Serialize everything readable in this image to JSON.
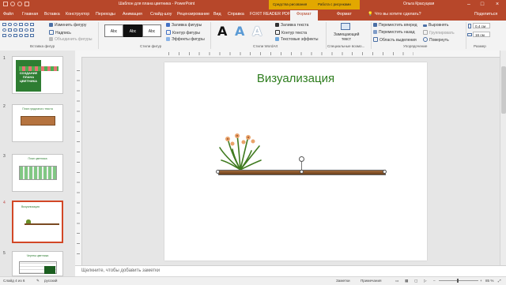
{
  "window": {
    "title": "Шаблон для плана цветника - PowerPoint",
    "context_group": "Средства рисования",
    "context_hint": "Работа с рисунками",
    "user": "Ольга Красуцкая",
    "share": "Поделиться"
  },
  "tabs": [
    {
      "label": "Файл"
    },
    {
      "label": "Главная"
    },
    {
      "label": "Вставка"
    },
    {
      "label": "Конструктор"
    },
    {
      "label": "Переходы"
    },
    {
      "label": "Анимация"
    },
    {
      "label": "Слайд-шоу"
    },
    {
      "label": "Рецензирование"
    },
    {
      "label": "Вид"
    },
    {
      "label": "Справка"
    },
    {
      "label": "FOXIT READER PDF"
    },
    {
      "label": "Формат"
    },
    {
      "label": "Формат"
    }
  ],
  "tell_me": "Что вы хотите сделать?",
  "ribbon": {
    "insert_shapes": {
      "edit_shape": "Изменить фигуру",
      "text_box": "Надпись",
      "merge_shapes": "Объединить фигуры",
      "label": "Вставка фигур"
    },
    "shape_styles": {
      "style_sample": "Abc",
      "fill": "Заливка фигуры",
      "outline": "Контур фигуры",
      "effects": "Эффекты фигуры",
      "label": "Стили фигур"
    },
    "wordart": {
      "letter": "A",
      "text_fill": "Заливка текста",
      "text_outline": "Контур текста",
      "text_effects": "Текстовые эффекты",
      "label": "Стили WordArt"
    },
    "accessibility": {
      "alt_text_l1": "Замещающий",
      "alt_text_l2": "текст",
      "label": "Специальные возмо..."
    },
    "arrange": {
      "forward": "Переместить вперед",
      "backward": "Переместить назад",
      "selection_pane": "Область выделения",
      "align": "Выровнять",
      "group": "Группировать",
      "rotate": "Повернуть",
      "label": "Упорядочение"
    },
    "size": {
      "height": "0,4 см",
      "width": "16 см",
      "label": "Размер"
    }
  },
  "thumbnails": [
    {
      "num": "1",
      "title_l1": "СОЗДАНИЕ",
      "title_l2": "ПЛАНА",
      "title_l3": "ЦВЕТНИКА"
    },
    {
      "num": "2",
      "title": "План грядочного текста"
    },
    {
      "num": "3",
      "title": "План цветника"
    },
    {
      "num": "4",
      "title": "Визуализация"
    },
    {
      "num": "5",
      "title": "Чертеж цветника"
    }
  ],
  "slide": {
    "title": "Визуализация",
    "title_color": "#2e7d1e"
  },
  "notes_placeholder": "Щелкните, чтобы добавить заметки",
  "status": {
    "slide_info": "Слайд 4 из 6",
    "language": "русский",
    "notes": "Заметки",
    "comments": "Примечания",
    "zoom": "85 %"
  },
  "colors": {
    "accent": "#b7472a",
    "context": "#e2a800",
    "selection": "#d24726"
  }
}
